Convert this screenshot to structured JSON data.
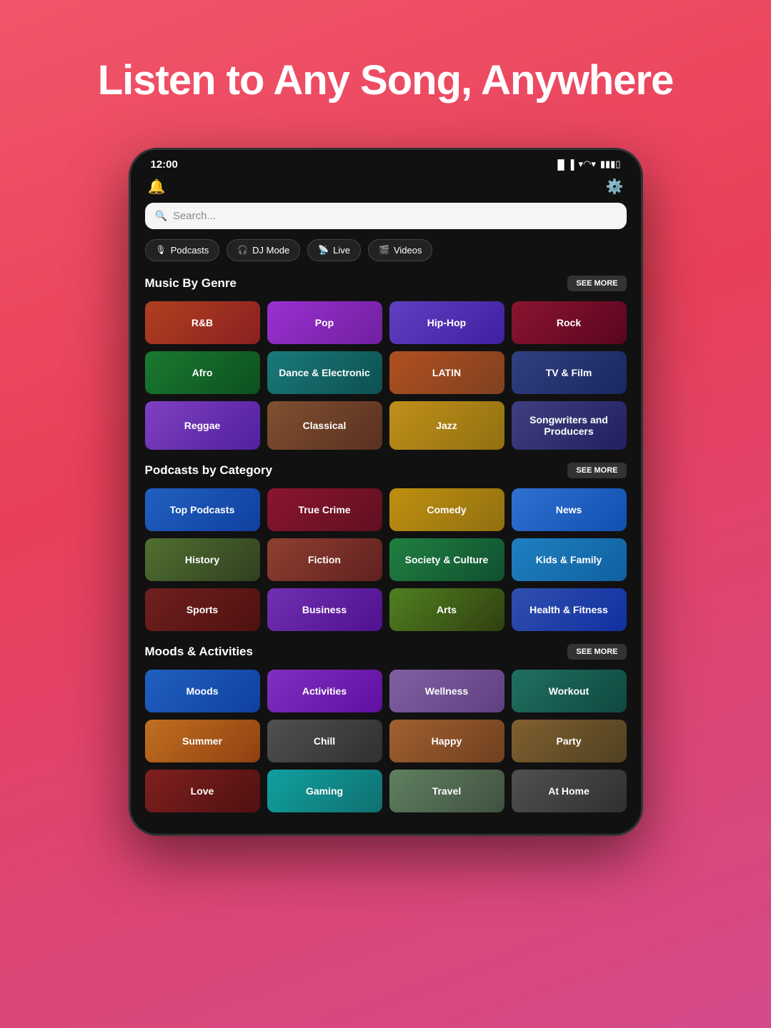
{
  "hero": {
    "title": "Listen to Any Song, Anywhere"
  },
  "statusBar": {
    "time": "12:00",
    "signal": "▐▐▐",
    "wifi": "WiFi",
    "battery": "🔋"
  },
  "search": {
    "placeholder": "Search..."
  },
  "navTabs": [
    {
      "id": "podcasts",
      "icon": "🎙",
      "label": "Podcasts"
    },
    {
      "id": "djmode",
      "icon": "🎧",
      "label": "DJ Mode"
    },
    {
      "id": "live",
      "icon": "📡",
      "label": "Live"
    },
    {
      "id": "videos",
      "icon": "🎬",
      "label": "Videos"
    }
  ],
  "musicSection": {
    "title": "Music By Genre",
    "seeMore": "SEE MORE",
    "tiles": [
      {
        "id": "rnb",
        "label": "R&B",
        "class": "tile-rnb"
      },
      {
        "id": "pop",
        "label": "Pop",
        "class": "tile-pop"
      },
      {
        "id": "hiphop",
        "label": "Hip-Hop",
        "class": "tile-hiphop"
      },
      {
        "id": "rock",
        "label": "Rock",
        "class": "tile-rock"
      },
      {
        "id": "afro",
        "label": "Afro",
        "class": "tile-afro"
      },
      {
        "id": "dance",
        "label": "Dance & Electronic",
        "class": "tile-dance"
      },
      {
        "id": "latin",
        "label": "LATIN",
        "class": "tile-latin"
      },
      {
        "id": "tvfilm",
        "label": "TV & Film",
        "class": "tile-tvfilm"
      },
      {
        "id": "reggae",
        "label": "Reggae",
        "class": "tile-reggae"
      },
      {
        "id": "classical",
        "label": "Classical",
        "class": "tile-classical"
      },
      {
        "id": "jazz",
        "label": "Jazz",
        "class": "tile-jazz"
      },
      {
        "id": "songwriters",
        "label": "Songwriters and Producers",
        "class": "tile-songwriters"
      }
    ]
  },
  "podcastsSection": {
    "title": "Podcasts by Category",
    "seeMore": "SEE MORE",
    "tiles": [
      {
        "id": "toppodcasts",
        "label": "Top Podcasts",
        "class": "tile-toppodcasts"
      },
      {
        "id": "truecrime",
        "label": "True Crime",
        "class": "tile-truecrime"
      },
      {
        "id": "comedy",
        "label": "Comedy",
        "class": "tile-comedy"
      },
      {
        "id": "news",
        "label": "News",
        "class": "tile-news"
      },
      {
        "id": "history",
        "label": "History",
        "class": "tile-history"
      },
      {
        "id": "fiction",
        "label": "Fiction",
        "class": "tile-fiction"
      },
      {
        "id": "society",
        "label": "Society & Culture",
        "class": "tile-society"
      },
      {
        "id": "kidsfamily",
        "label": "Kids & Family",
        "class": "tile-kidsfamily"
      },
      {
        "id": "sports",
        "label": "Sports",
        "class": "tile-sports"
      },
      {
        "id": "business",
        "label": "Business",
        "class": "tile-business"
      },
      {
        "id": "arts",
        "label": "Arts",
        "class": "tile-arts"
      },
      {
        "id": "healthfitness",
        "label": "Health & Fitness",
        "class": "tile-healthfitness"
      }
    ]
  },
  "moodsSection": {
    "title": "Moods & Activities",
    "seeMore": "SEE MORE",
    "tiles": [
      {
        "id": "moods",
        "label": "Moods",
        "class": "tile-moods"
      },
      {
        "id": "activities",
        "label": "Activities",
        "class": "tile-activities"
      },
      {
        "id": "wellness",
        "label": "Wellness",
        "class": "tile-wellness"
      },
      {
        "id": "workout",
        "label": "Workout",
        "class": "tile-workout"
      },
      {
        "id": "summer",
        "label": "Summer",
        "class": "tile-summer"
      },
      {
        "id": "chill",
        "label": "Chill",
        "class": "tile-chill"
      },
      {
        "id": "happy",
        "label": "Happy",
        "class": "tile-happy"
      },
      {
        "id": "party",
        "label": "Party",
        "class": "tile-party"
      },
      {
        "id": "love",
        "label": "Love",
        "class": "tile-love"
      },
      {
        "id": "gaming",
        "label": "Gaming",
        "class": "tile-gaming"
      },
      {
        "id": "travel",
        "label": "Travel",
        "class": "tile-travel"
      },
      {
        "id": "athome",
        "label": "At Home",
        "class": "tile-athome"
      }
    ]
  }
}
